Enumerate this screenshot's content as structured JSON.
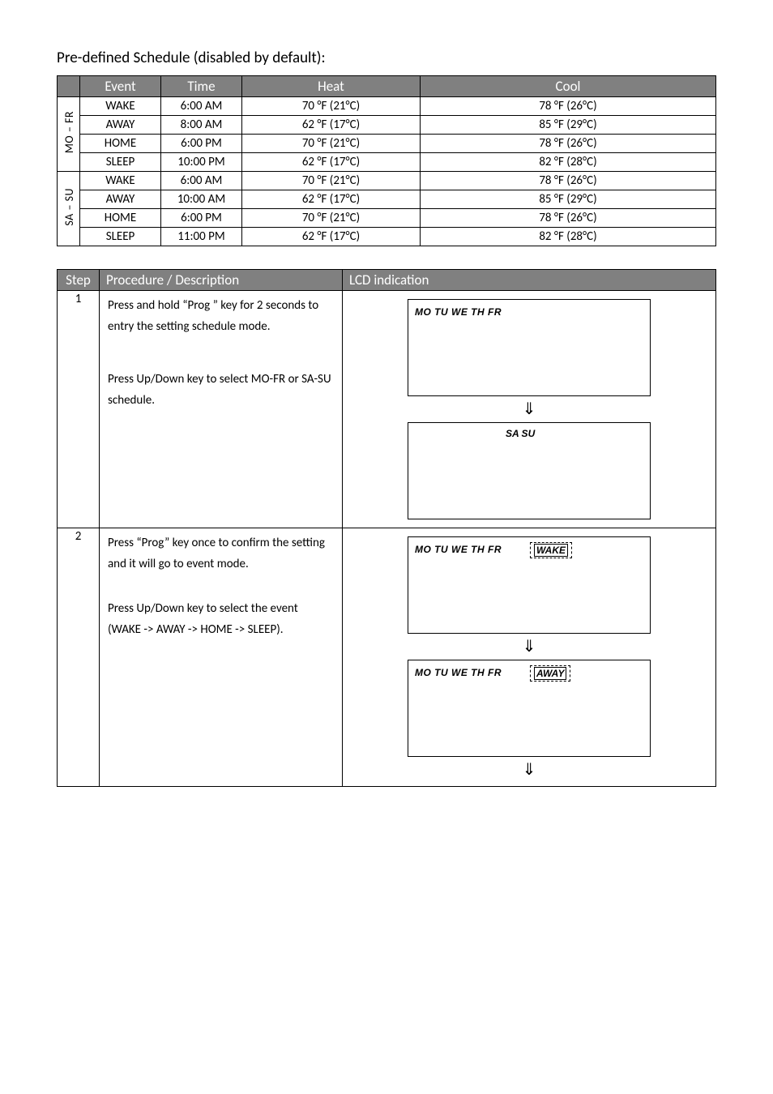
{
  "title": "Pre-defined Schedule (disabled by default):",
  "schedule": {
    "headers": {
      "event": "Event",
      "time": "Time",
      "heat": "Heat",
      "cool": "Cool"
    },
    "groups": [
      {
        "label": "MO – FR",
        "rows": [
          {
            "event": "WAKE",
            "time": "6:00 AM",
            "heat": "70 °F (21°C)",
            "cool": "78 °F (26°C)"
          },
          {
            "event": "AWAY",
            "time": "8:00 AM",
            "heat": "62 °F (17°C)",
            "cool": "85 °F (29°C)"
          },
          {
            "event": "HOME",
            "time": "6:00 PM",
            "heat": "70 °F (21°C)",
            "cool": "78 °F (26°C)"
          },
          {
            "event": "SLEEP",
            "time": "10:00 PM",
            "heat": "62 °F (17°C)",
            "cool": "82 °F (28°C)"
          }
        ]
      },
      {
        "label": "SA – SU",
        "rows": [
          {
            "event": "WAKE",
            "time": "6:00 AM",
            "heat": "70 °F (21°C)",
            "cool": "78 °F (26°C)"
          },
          {
            "event": "AWAY",
            "time": "10:00 AM",
            "heat": "62 °F (17°C)",
            "cool": "85 °F (29°C)"
          },
          {
            "event": "HOME",
            "time": "6:00 PM",
            "heat": "70 °F (21°C)",
            "cool": "78 °F (26°C)"
          },
          {
            "event": "SLEEP",
            "time": "11:00 PM",
            "heat": "62 °F (17°C)",
            "cool": "82 °F (28°C)"
          }
        ]
      }
    ]
  },
  "procedure": {
    "headers": {
      "step": "Step",
      "desc": "Procedure / Description",
      "lcd": "LCD indication"
    },
    "steps": [
      {
        "num": "1",
        "desc_p1": "Press and hold “Prog ” key for 2 seconds to entry the setting schedule mode.",
        "desc_p2": "Press Up/Down key to select MO-FR or SA-SU schedule.",
        "lcd1_days": "MO TU WE TH FR",
        "lcd2_days": "SA SU"
      },
      {
        "num": "2",
        "desc_p1": "Press “Prog” key once to confirm the setting and it will go to event mode.",
        "desc_p2": "Press Up/Down key to select the event (WAKE -> AWAY -> HOME -> SLEEP).",
        "lcd1_days": "MO TU WE TH FR",
        "lcd1_badge": "WAKE",
        "lcd2_days": "MO TU WE TH FR",
        "lcd2_badge": "AWAY"
      }
    ]
  },
  "arrow": "⇓"
}
